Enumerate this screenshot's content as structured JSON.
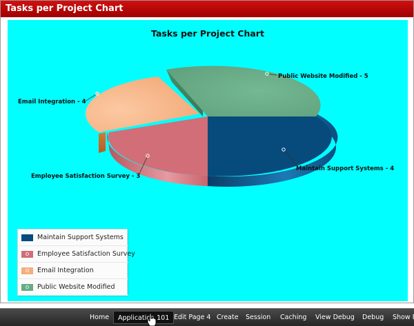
{
  "region": {
    "title": "Tasks per Project Chart"
  },
  "colors": {
    "header": "#b00000",
    "chart_background": "#00ffff",
    "series": [
      "#064b7c",
      "#d26e77",
      "#f4ad7e",
      "#66ab85"
    ]
  },
  "chart_data": {
    "type": "pie",
    "style": "3d-exploded",
    "title": "Tasks per Project Chart",
    "slices": [
      {
        "label": "Maintain Support Systems",
        "value": 4,
        "data_label": "Maintain Support Systems - 4",
        "color": "#064b7c"
      },
      {
        "label": "Employee Satisfaction Survey",
        "value": 3,
        "data_label": "Employee Satisfaction Survey - 3",
        "color": "#d26e77"
      },
      {
        "label": "Email Integration",
        "value": 4,
        "data_label": "Email Integration - 4",
        "color": "#f4ad7e"
      },
      {
        "label": "Public Website Modified",
        "value": 5,
        "data_label": "Public Website Modified - 5",
        "color": "#66ab85"
      }
    ],
    "legend_position": "bottom-left"
  },
  "legend": {
    "items": [
      {
        "label": "Maintain Support Systems",
        "color": "#064b7c",
        "marker": false
      },
      {
        "label": "Employee Satisfaction Survey",
        "color": "#d26e77",
        "marker": true
      },
      {
        "label": "Email Integration",
        "color": "#f4ad7e",
        "marker": true
      },
      {
        "label": "Public Website Modified",
        "color": "#66ab85",
        "marker": true
      }
    ]
  },
  "devbar": {
    "items": [
      {
        "label": "Home",
        "active": false
      },
      {
        "label": "Application 101",
        "active": true
      },
      {
        "label": "Edit Page 4",
        "active": false
      },
      {
        "label": "Create",
        "active": false
      },
      {
        "label": "Session",
        "active": false
      },
      {
        "label": "Caching",
        "active": false
      },
      {
        "label": "View Debug",
        "active": false
      },
      {
        "label": "Debug",
        "active": false
      },
      {
        "label": "Show Ed",
        "active": false
      }
    ]
  }
}
